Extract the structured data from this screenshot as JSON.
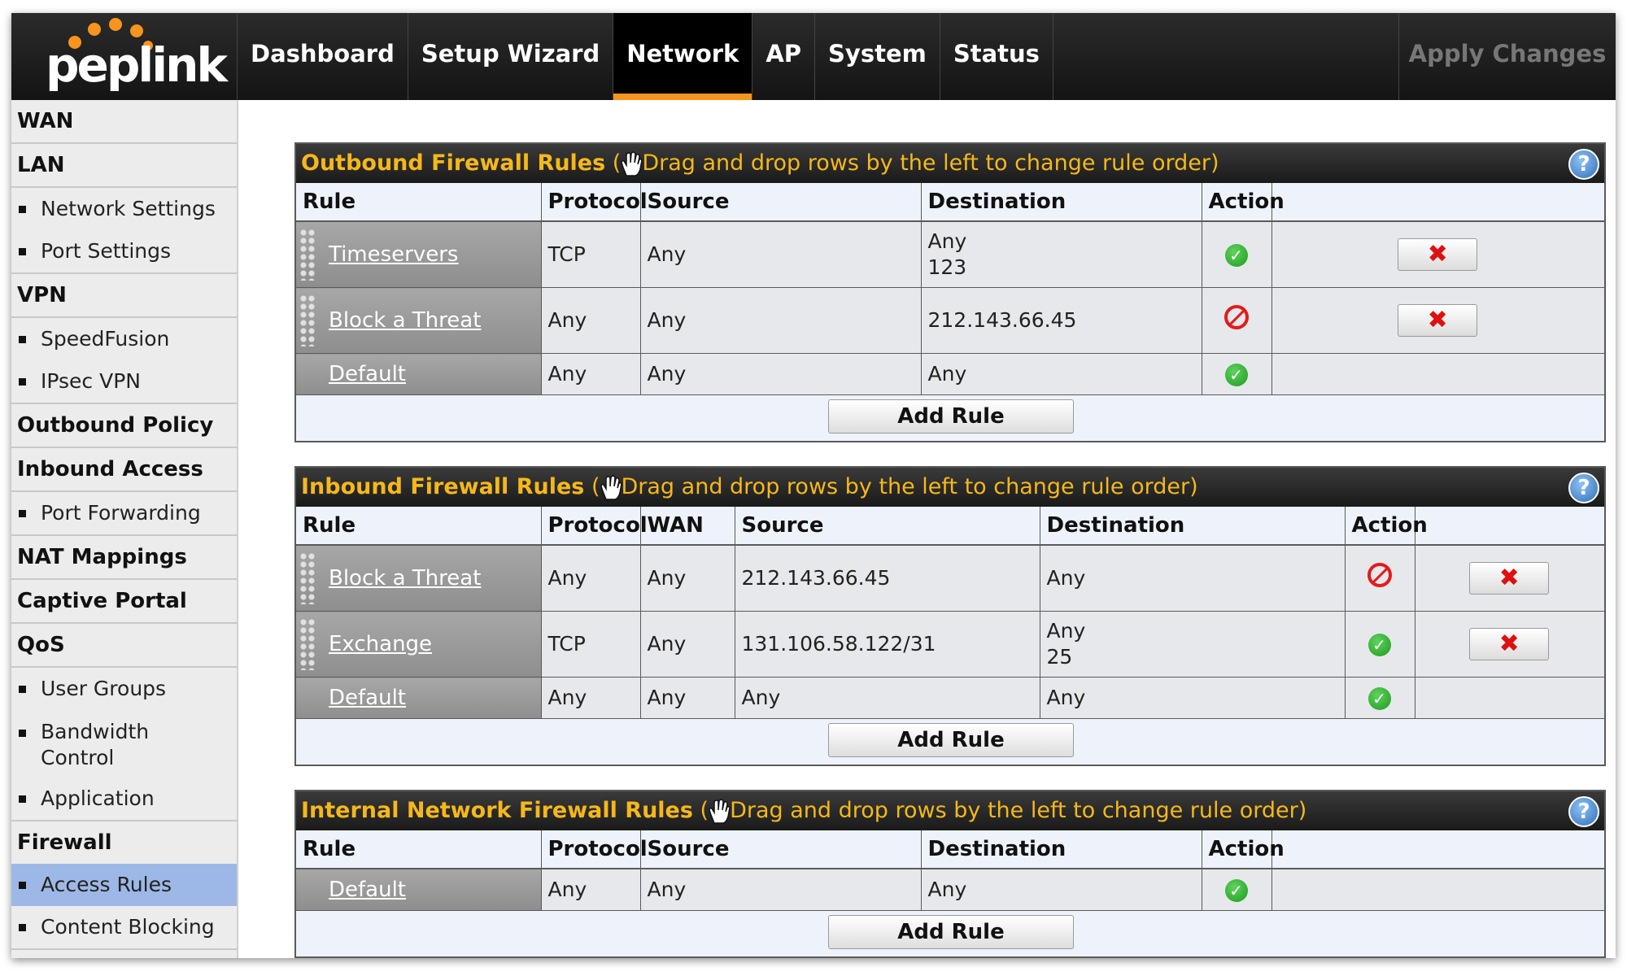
{
  "app": {
    "logo_text": "peplink",
    "nav": [
      "Dashboard",
      "Setup Wizard",
      "Network",
      "AP",
      "System",
      "Status"
    ],
    "active_tab": "Network",
    "apply_label": "Apply Changes",
    "accent_color": "#f7941d",
    "title_color": "#f5b81a"
  },
  "sidebar": {
    "sections": [
      {
        "title": "WAN",
        "items": []
      },
      {
        "title": "LAN",
        "items": [
          "Network Settings",
          "Port Settings"
        ]
      },
      {
        "title": "VPN",
        "items": [
          "SpeedFusion",
          "IPsec VPN"
        ]
      },
      {
        "title": "Outbound Policy",
        "items": []
      },
      {
        "title": "Inbound Access",
        "items": [
          "Port Forwarding"
        ]
      },
      {
        "title": "NAT Mappings",
        "items": []
      },
      {
        "title": "Captive Portal",
        "items": []
      },
      {
        "title": "QoS",
        "items": [
          "User Groups",
          "Bandwidth Control",
          "Application"
        ]
      },
      {
        "title": "Firewall",
        "items": [
          "Access Rules",
          "Content Blocking"
        ]
      }
    ],
    "bandwidth_line1": "Bandwidth",
    "bandwidth_line2": "Control",
    "selected_item": "Access Rules"
  },
  "panels": {
    "outbound": {
      "title": "Outbound Firewall Rules",
      "hint": "Drag and drop rows by the left to change rule order)",
      "paren_open": " (",
      "headers": [
        "Rule",
        "Protocol",
        "Source",
        "Destination",
        "Action"
      ],
      "rows": [
        {
          "rule": "Timeservers",
          "protocol": "TCP",
          "source": "Any",
          "destination": "Any",
          "destination_port": "123",
          "action": "allow",
          "deletable": true
        },
        {
          "rule": "Block a Threat",
          "protocol": "Any",
          "source": "Any",
          "destination": "212.143.66.45",
          "action": "deny",
          "deletable": true
        },
        {
          "rule": "Default",
          "protocol": "Any",
          "source": "Any",
          "destination": "Any",
          "action": "allow",
          "deletable": false
        }
      ],
      "add_label": "Add Rule"
    },
    "inbound": {
      "title": "Inbound Firewall Rules",
      "hint": "Drag and drop rows by the left to change rule order)",
      "paren_open": " (",
      "headers": [
        "Rule",
        "Protocol",
        "WAN",
        "Source",
        "Destination",
        "Action"
      ],
      "rows": [
        {
          "rule": "Block a Threat",
          "protocol": "Any",
          "wan": "Any",
          "source": "212.143.66.45",
          "destination": "Any",
          "action": "deny",
          "deletable": true
        },
        {
          "rule": "Exchange",
          "protocol": "TCP",
          "wan": "Any",
          "source": "131.106.58.122/31",
          "destination": "Any",
          "destination_port": "25",
          "action": "allow",
          "deletable": true
        },
        {
          "rule": "Default",
          "protocol": "Any",
          "wan": "Any",
          "source": "Any",
          "destination": "Any",
          "action": "allow",
          "deletable": false
        }
      ],
      "add_label": "Add Rule"
    },
    "internal": {
      "title": "Internal Network Firewall Rules",
      "hint": "Drag and drop rows by the left to change rule order)",
      "paren_open": " (",
      "headers": [
        "Rule",
        "Protocol",
        "Source",
        "Destination",
        "Action"
      ],
      "rows": [
        {
          "rule": "Default",
          "protocol": "Any",
          "source": "Any",
          "destination": "Any",
          "action": "allow",
          "deletable": false
        }
      ],
      "add_label": "Add Rule"
    }
  },
  "icons": {
    "help": "?",
    "allow": "✓",
    "delete": "✖",
    "hand": "hand-pointer-icon"
  }
}
